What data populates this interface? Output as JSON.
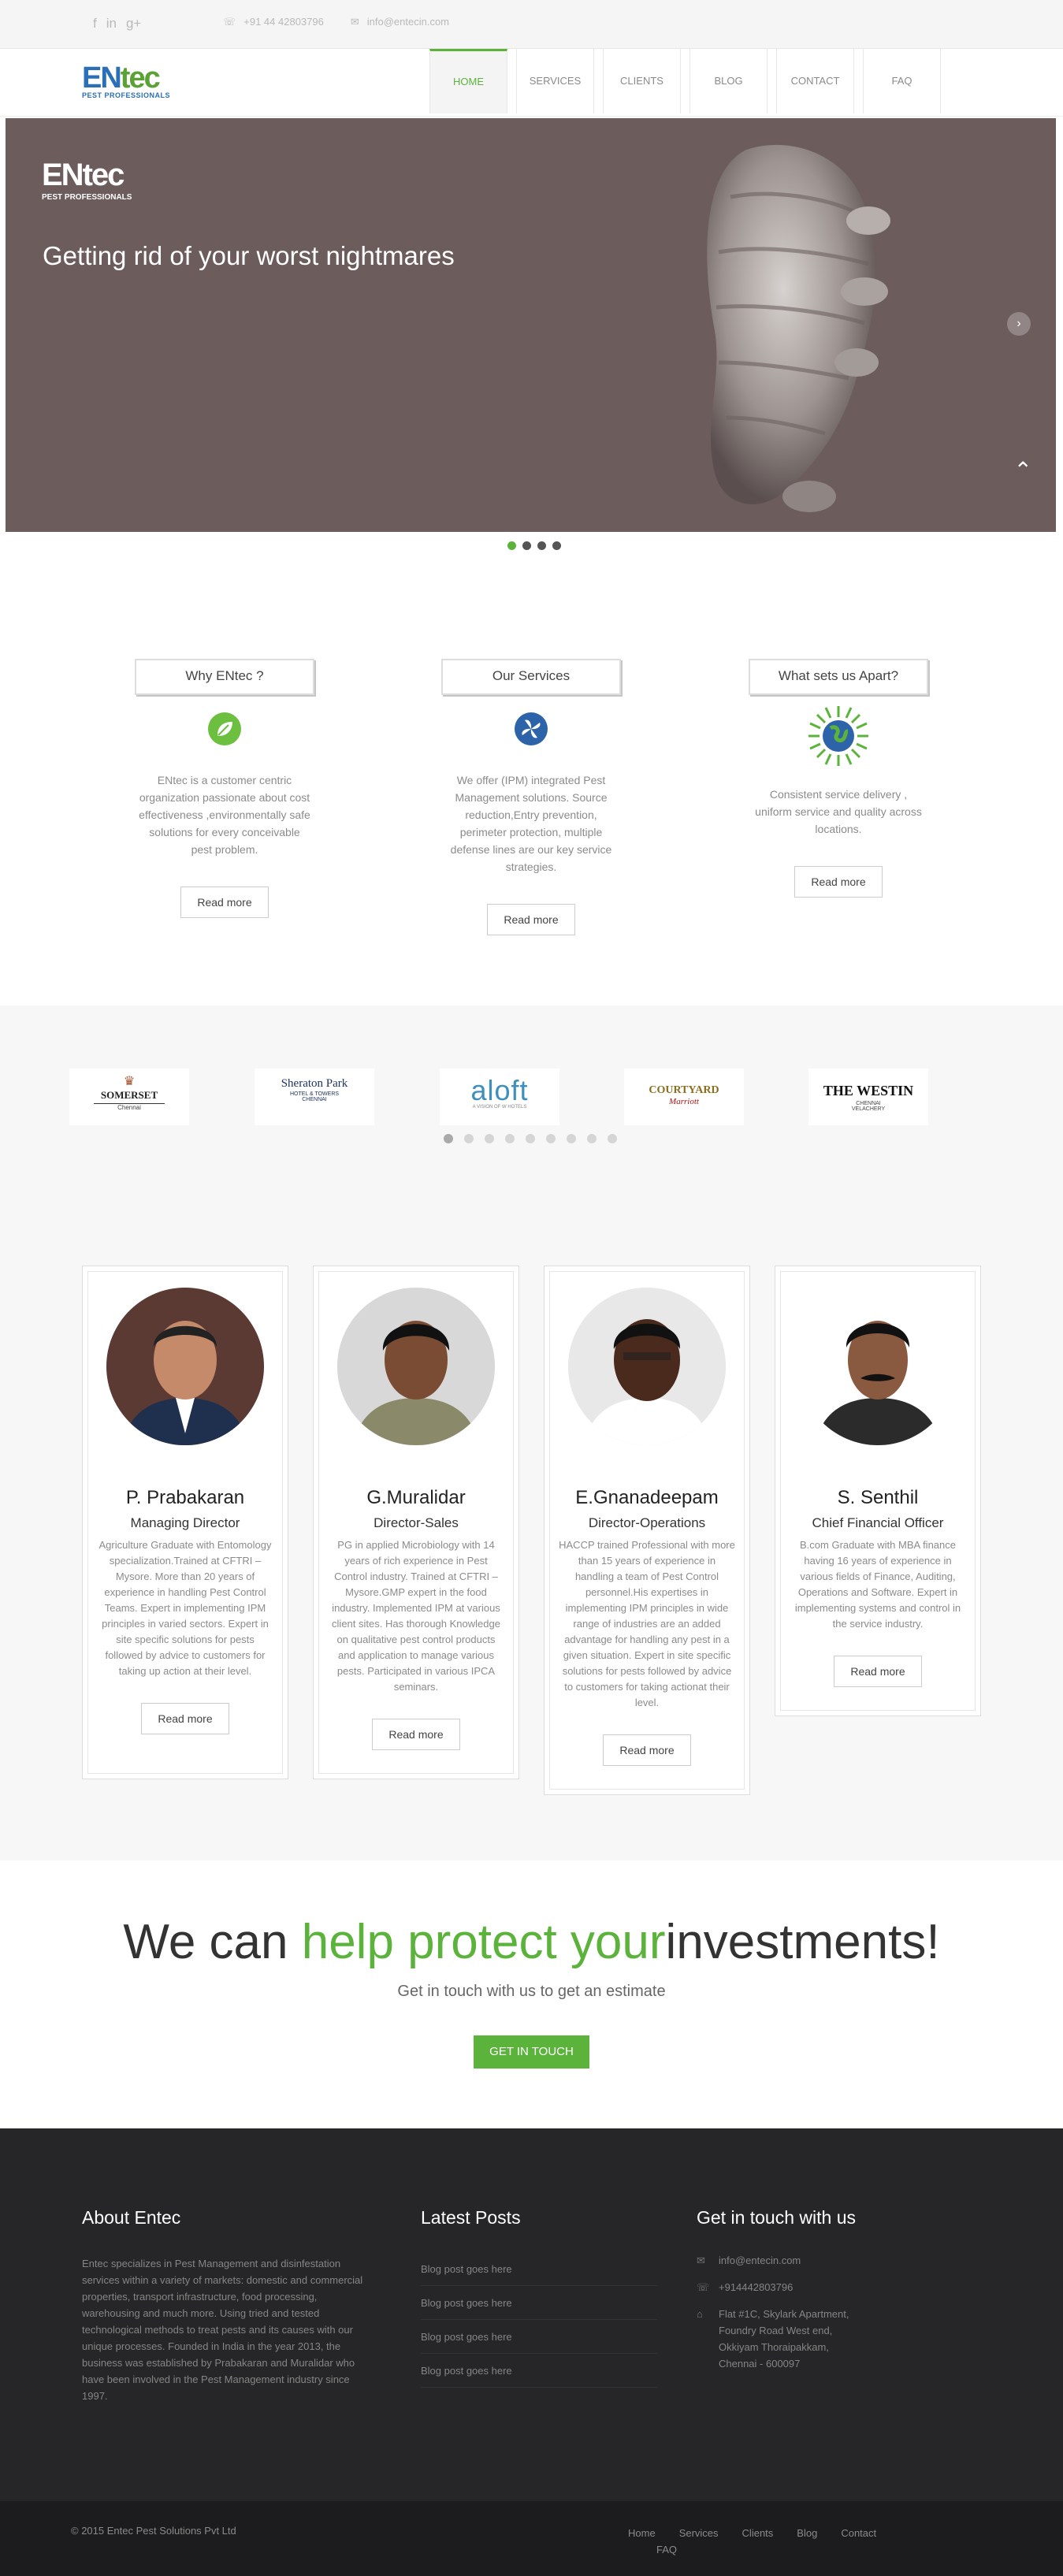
{
  "topbar": {
    "social": [
      "f",
      "in",
      "g+"
    ],
    "phone": "+91 44 42803796",
    "email": "info@entecin.com"
  },
  "logo": {
    "brand_a": "EN",
    "brand_b": "tec",
    "tagline": "PEST PROFESSIONALS"
  },
  "nav": [
    "HOME",
    "SERVICES",
    "CLIENTS",
    "BLOG",
    "CONTACT",
    "FAQ"
  ],
  "slider": {
    "logo_brand": "ENtec",
    "logo_tagline": "PEST PROFESSIONALS",
    "headline": "Getting rid of your worst nightmares",
    "slides": 4,
    "active_slide": 1
  },
  "features": [
    {
      "title": "Why ENtec ?",
      "text": "ENtec is a customer centric organization passionate about cost effectiveness ,environmentally safe solutions for every conceivable pest problem.",
      "button": "Read more"
    },
    {
      "title": "Our Services",
      "text": "We offer (IPM) integrated Pest Management solutions. Source reduction,Entry prevention, perimeter protection, multiple defense lines are our key service strategies.",
      "button": "Read more"
    },
    {
      "title": "What sets us Apart?",
      "text": "Consistent service delivery , uniform service and quality across locations.",
      "button": "Read more"
    }
  ],
  "clients": [
    {
      "name": "SOMERSET",
      "sub": "Chennai"
    },
    {
      "name": "Sheraton Park",
      "sub": "HOTEL & TOWERS CHENNAI"
    },
    {
      "name": "aloft",
      "sub": "A VISION OF W HOTELS"
    },
    {
      "name": "COURTYARD",
      "sub": "Marriott"
    },
    {
      "name": "THE WESTIN",
      "sub": "CHENNAI VELACHERY"
    }
  ],
  "client_pages": 9,
  "team": [
    {
      "name": "P. Prabakaran",
      "role": "Managing Director",
      "bio": "Agriculture Graduate with Entomology specialization.Trained at CFTRI – Mysore. More than 20 years of experience in handling Pest Control Teams. Expert in implementing IPM principles in varied sectors. Expert in site specific solutions for pests followed by advice to customers for taking up action at their level.",
      "button": "Read more"
    },
    {
      "name": "G.Muralidar",
      "role": "Director-Sales",
      "bio": "PG in applied Microbiology with 14 years of rich experience in Pest Control industry. Trained at CFTRI – Mysore.GMP expert in the food industry. Implemented IPM at various client sites. Has thorough Knowledge on qualitative pest control products and application to manage various pests. Participated in various IPCA seminars.",
      "button": "Read more"
    },
    {
      "name": "E.Gnanadeepam",
      "role": "Director-Operations",
      "bio": "HACCP trained Professional with more than 15 years of experience in handling a team of Pest Control personnel.His expertises in implementing IPM principles in wide range of industries are an added advantage for handling any pest in a given situation. Expert in site specific solutions for pests followed by advice to customers for taking actionat their level.",
      "button": "Read more"
    },
    {
      "name": "S. Senthil",
      "role": "Chief Financial Officer",
      "bio": "B.com Graduate with MBA finance having 16 years of experience in various fields of Finance, Auditing, Operations and Software. Expert in implementing systems and control in the service industry.",
      "button": "Read more"
    }
  ],
  "cta": {
    "headline_a": "We can ",
    "headline_b": "help protect your",
    "headline_c": "investments!",
    "sub": "Get in touch with us to get an estimate",
    "button": "GET IN TOUCH"
  },
  "footer": {
    "about_title": "About Entec",
    "about_text": "Entec specializes in Pest Management and disinfestation services within a variety of markets: domestic and commercial properties, transport infrastructure, food processing, warehousing and much more. Using tried and tested technological methods to treat pests and its causes with our unique processes. Founded in India in the year 2013, the business was established by Prabakaran and Muralidar who have been involved in the Pest Management industry since 1997.",
    "posts_title": "Latest Posts",
    "posts": [
      "Blog post goes here",
      "Blog post goes here",
      "Blog post goes here",
      "Blog post goes here"
    ],
    "touch_title": "Get in touch with us",
    "email": "info@entecin.com",
    "phone": "+914442803796",
    "address": [
      "Flat #1C, Skylark Apartment,",
      "Foundry Road West end,",
      "Okkiyam Thoraipakkam,",
      "Chennai - 600097"
    ]
  },
  "bottom": {
    "copyright": "© 2015 Entec Pest Solutions Pvt Ltd",
    "links": [
      "Home",
      "Services",
      "Clients",
      "Blog",
      "Contact",
      "FAQ"
    ]
  }
}
